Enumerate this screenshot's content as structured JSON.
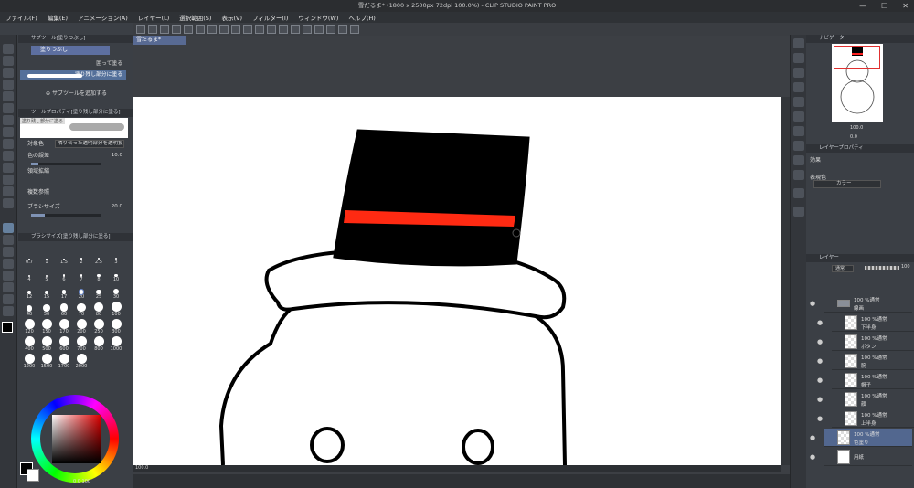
{
  "window": {
    "title": "雪だるま* (1800 x 2500px 72dpi 100.0%)  - CLIP STUDIO PAINT PRO",
    "minimize": "—",
    "maximize": "☐",
    "close": "✕"
  },
  "menu": [
    "ファイル(F)",
    "編集(E)",
    "アニメーション(A)",
    "レイヤー(L)",
    "選択範囲(S)",
    "表示(V)",
    "フィルター(I)",
    "ウィンドウ(W)",
    "ヘルプ(H)"
  ],
  "document": {
    "tab": "雪だるま*",
    "zoom": "100.0"
  },
  "subtool_panel": {
    "header": "サブツール[塗りつぶし]",
    "active_group": "塗りつぶし",
    "items": [
      {
        "label": "囲って塗る",
        "selected": false
      },
      {
        "label": "塗り残し部分に塗る",
        "selected": true
      }
    ],
    "add_label": "サブツールを追加する"
  },
  "tool_property": {
    "header": "ツールプロパティ[塗り残し部分に塗る]",
    "preview_name": "塗り残し部分に塗る",
    "target_label": "対象色",
    "target_value": "隣り合った透明部分を透明扱い",
    "tolerance_label": "色の誤差",
    "tolerance_value": "10.0",
    "expand_label": "領域拡縮",
    "ref_label": "複数参照",
    "brush_label": "ブラシサイズ",
    "brush_value": "20.0"
  },
  "brush_size_panel": {
    "header": "ブラシサイズ[塗り残し部分に塗る]",
    "sizes": [
      "0.7",
      "1",
      "1.5",
      "2",
      "2.5",
      "3",
      "4",
      "5",
      "6",
      "7",
      "8",
      "10",
      "12",
      "15",
      "17",
      "20",
      "25",
      "30",
      "40",
      "50",
      "60",
      "70",
      "80",
      "100",
      "120",
      "150",
      "170",
      "200",
      "250",
      "300",
      "400",
      "500",
      "600",
      "700",
      "800",
      "1000",
      "1200",
      "1500",
      "1700",
      "2000"
    ],
    "selected": "20"
  },
  "color_panel": {
    "main_color": "#000000",
    "sub_color": "#ffffff",
    "values": "0 0 100"
  },
  "navigator": {
    "header": "ナビゲーター",
    "zoom_value": "100.0",
    "angle_value": "0.0"
  },
  "layer_property": {
    "header": "レイヤープロパティ",
    "effect_label": "効果",
    "expression_label": "表現色",
    "expression_value": "カラー"
  },
  "layer_panel": {
    "header": "レイヤー",
    "blend_mode": "通常",
    "opacity": "100",
    "layers": [
      {
        "mode": "100 %通常",
        "name": "線画",
        "folder": true,
        "selected": false
      },
      {
        "mode": "100 %通常",
        "name": "下半身",
        "folder": false,
        "selected": false
      },
      {
        "mode": "100 %通常",
        "name": "ボタン",
        "folder": false,
        "selected": false
      },
      {
        "mode": "100 %通常",
        "name": "腕",
        "folder": false,
        "selected": false
      },
      {
        "mode": "100 %通常",
        "name": "帽子",
        "folder": false,
        "selected": false
      },
      {
        "mode": "100 %通常",
        "name": "顔",
        "folder": false,
        "selected": false
      },
      {
        "mode": "100 %通常",
        "name": "上半身",
        "folder": false,
        "selected": false
      },
      {
        "mode": "100 %通常",
        "name": "色塗り",
        "folder": false,
        "selected": true
      },
      {
        "mode": "",
        "name": "用紙",
        "folder": false,
        "selected": false
      }
    ]
  },
  "colors": {
    "accent": "#5d6fa0",
    "hat_band": "#ff2a12",
    "hat": "#000000",
    "paper": "#ffffff"
  }
}
